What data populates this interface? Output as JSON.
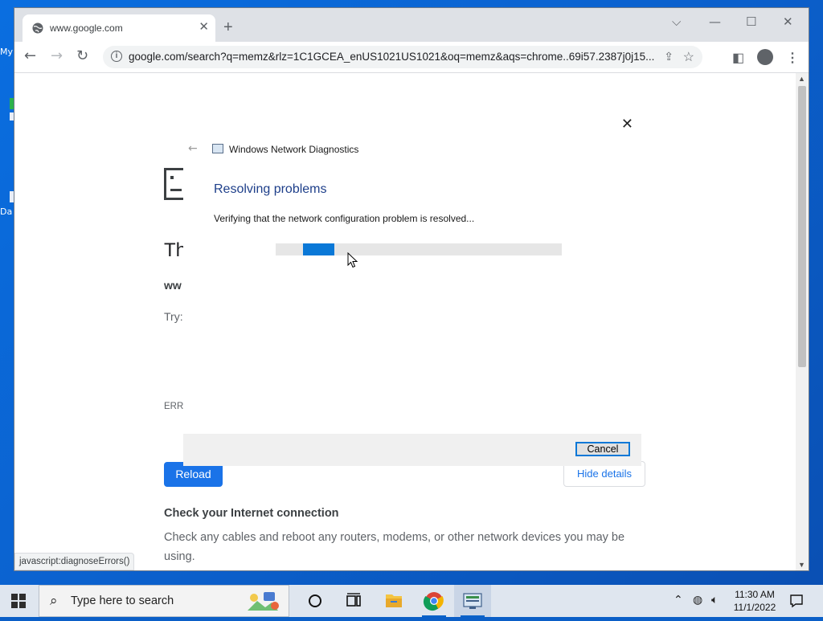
{
  "desktop": {
    "icon_labels": [
      "My",
      "Da"
    ]
  },
  "browser": {
    "tab": {
      "title": "www.google.com"
    },
    "window_controls": {
      "tab_search": "⌵",
      "minimize": "—",
      "maximize": "☐",
      "close": "✕"
    },
    "nav": {
      "back": "←",
      "forward": "→",
      "reload": "↻"
    },
    "address": {
      "url": "google.com/search?q=memz&rlz=1C1GCEA_enUS1021US1021&oq=memz&aqs=chrome..69i57.2387j0j15..."
    },
    "status_text": "javascript:diagnoseErrors()"
  },
  "error_page": {
    "heading_partial": "Th",
    "domain_partial": "ww",
    "try_label": "Try:",
    "error_code_partial": "ERR_",
    "reload_button": "Reload",
    "details_button": "Hide details",
    "check_heading": "Check your Internet connection",
    "check_body": "Check any cables and reboot any routers, modems, or other network devices you may be using."
  },
  "dialog": {
    "app_title": "Windows Network Diagnostics",
    "heading": "Resolving problems",
    "message": "Verifying that the network configuration problem is resolved...",
    "cancel_button": "Cancel",
    "close_glyph": "✕",
    "back_glyph": "←",
    "progress": {
      "indeterminate": true
    }
  },
  "taskbar": {
    "search_placeholder": "Type here to search",
    "clock_time": "11:30 AM",
    "clock_date": "11/1/2022",
    "accent_color": "#0a63c9"
  }
}
